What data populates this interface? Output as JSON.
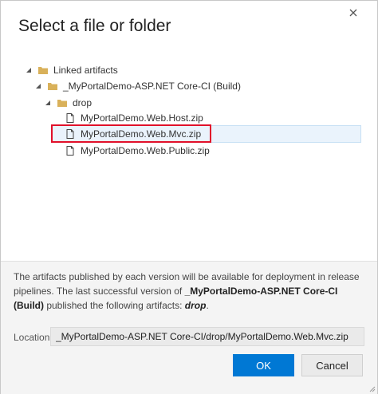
{
  "dialog": {
    "title": "Select a file or folder",
    "close_icon": "close-icon"
  },
  "tree": {
    "root": {
      "label": "Linked artifacts",
      "icon": "folder-icon",
      "expanded": true
    },
    "build": {
      "label": "_MyPortalDemo-ASP.NET Core-CI (Build)",
      "icon": "folder-icon",
      "expanded": true
    },
    "drop": {
      "label": "drop",
      "icon": "folder-icon",
      "expanded": true
    },
    "files": [
      {
        "label": "MyPortalDemo.Web.Host.zip",
        "icon": "file-icon",
        "selected": false
      },
      {
        "label": "MyPortalDemo.Web.Mvc.zip",
        "icon": "file-icon",
        "selected": true
      },
      {
        "label": "MyPortalDemo.Web.Public.zip",
        "icon": "file-icon",
        "selected": false
      }
    ]
  },
  "footer": {
    "info_part1": "The artifacts published by each version will be available for deployment in release pipelines. The last successful version of ",
    "info_bold": "_MyPortalDemo-ASP.NET Core-CI (Build)",
    "info_part2": " published the following artifacts: ",
    "info_artifact": "drop",
    "info_end": ".",
    "location_label": "Location",
    "location_value": "_MyPortalDemo-ASP.NET Core-CI/drop/MyPortalDemo.Web.Mvc.zip",
    "ok_label": "OK",
    "cancel_label": "Cancel"
  },
  "colors": {
    "accent": "#0078d4",
    "folder": "#d9b15a",
    "highlight": "#e1102a"
  }
}
